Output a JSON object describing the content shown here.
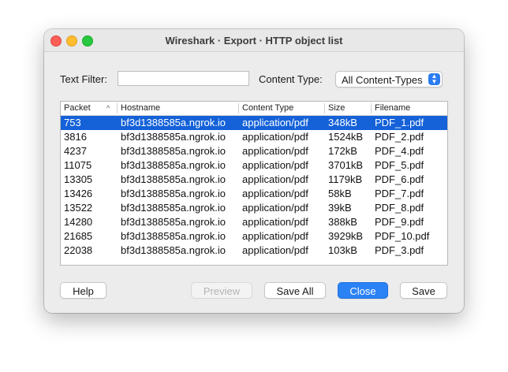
{
  "window": {
    "title": "Wireshark · Export · HTTP object list"
  },
  "filter": {
    "text_filter_label": "Text Filter:",
    "text_filter_value": "",
    "content_type_label": "Content Type:",
    "content_type_selected": "All Content-Types"
  },
  "icons": {
    "sort": "sort-ascending-icon",
    "dropdown": "chevron-up-down-icon"
  },
  "table": {
    "columns": [
      "Packet",
      "Hostname",
      "Content Type",
      "Size",
      "Filename"
    ],
    "selected_row": 0,
    "rows": [
      [
        "753",
        "bf3d1388585a.ngrok.io",
        "application/pdf",
        "348kB",
        "PDF_1.pdf"
      ],
      [
        "3816",
        "bf3d1388585a.ngrok.io",
        "application/pdf",
        "1524kB",
        "PDF_2.pdf"
      ],
      [
        "4237",
        "bf3d1388585a.ngrok.io",
        "application/pdf",
        "172kB",
        "PDF_4.pdf"
      ],
      [
        "11075",
        "bf3d1388585a.ngrok.io",
        "application/pdf",
        "3701kB",
        "PDF_5.pdf"
      ],
      [
        "13305",
        "bf3d1388585a.ngrok.io",
        "application/pdf",
        "1179kB",
        "PDF_6.pdf"
      ],
      [
        "13426",
        "bf3d1388585a.ngrok.io",
        "application/pdf",
        "58kB",
        "PDF_7.pdf"
      ],
      [
        "13522",
        "bf3d1388585a.ngrok.io",
        "application/pdf",
        "39kB",
        "PDF_8.pdf"
      ],
      [
        "14280",
        "bf3d1388585a.ngrok.io",
        "application/pdf",
        "388kB",
        "PDF_9.pdf"
      ],
      [
        "21685",
        "bf3d1388585a.ngrok.io",
        "application/pdf",
        "3929kB",
        "PDF_10.pdf"
      ],
      [
        "22038",
        "bf3d1388585a.ngrok.io",
        "application/pdf",
        "103kB",
        "PDF_3.pdf"
      ]
    ]
  },
  "buttons": {
    "help": "Help",
    "preview": "Preview",
    "save_all": "Save All",
    "close": "Close",
    "save": "Save"
  },
  "colors": {
    "selection": "#1461d8",
    "primary_button": "#2a82f5"
  }
}
